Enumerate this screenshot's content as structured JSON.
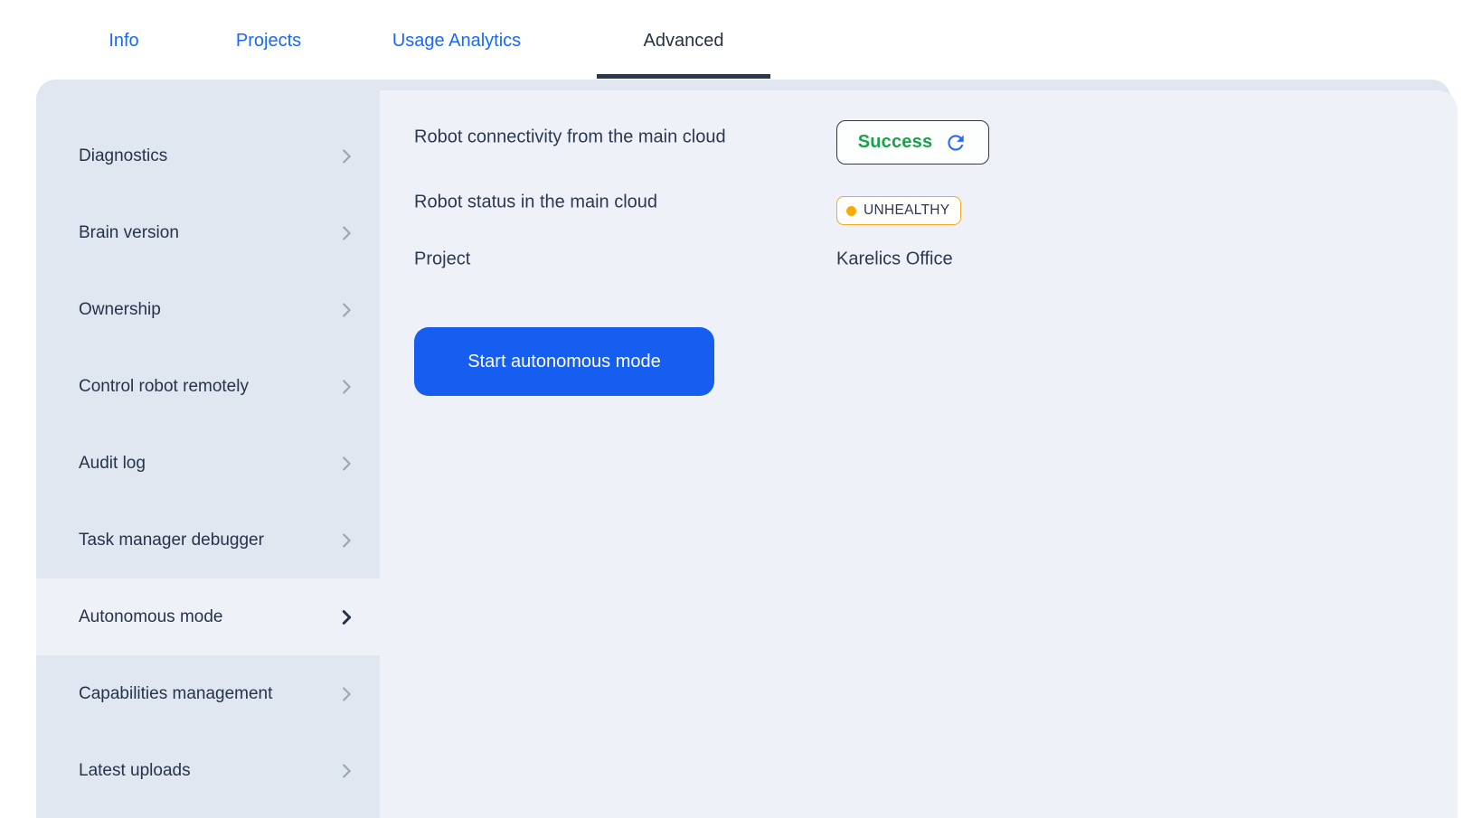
{
  "tabs": [
    {
      "label": "Info",
      "active": false
    },
    {
      "label": "Projects",
      "active": false
    },
    {
      "label": "Usage Analytics",
      "active": false
    },
    {
      "label": "Advanced",
      "active": true
    }
  ],
  "sidebar": {
    "selected": "Autonomous mode",
    "items": [
      {
        "label": "Diagnostics"
      },
      {
        "label": "Brain version"
      },
      {
        "label": "Ownership"
      },
      {
        "label": "Control robot remotely"
      },
      {
        "label": "Audit log"
      },
      {
        "label": "Task manager debugger"
      },
      {
        "label": "Autonomous mode"
      },
      {
        "label": "Capabilities management"
      },
      {
        "label": "Latest uploads"
      }
    ]
  },
  "main": {
    "rows": [
      {
        "label": "Robot connectivity from the main cloud",
        "value": "Success",
        "value_kind": "status-check"
      },
      {
        "label": "Robot status in the main cloud",
        "value": "UNHEALTHY",
        "value_kind": "health-badge"
      },
      {
        "label": "Project",
        "value": "Karelics Office",
        "value_kind": "text"
      }
    ],
    "button_label": "Start autonomous mode"
  },
  "icons": {
    "refresh": "refresh-icon",
    "chevron": "chevron-right-icon"
  },
  "colors": {
    "tab_link_blue": "#1769fa",
    "active_tab_text": "#29323f",
    "active_tab_underline": "#2d3748",
    "sidebar_bg": "#e1e7f0",
    "content_bg": "#eef2f8",
    "text_dark": "#2b3950",
    "success_green": "#19a24a",
    "refresh_blue": "#2b6bf3",
    "warning_amber": "#f2ac1f",
    "warning_dot": "#f7ab07",
    "button_blue": "#155eef",
    "chevron_gray": "#9aa7b8"
  }
}
